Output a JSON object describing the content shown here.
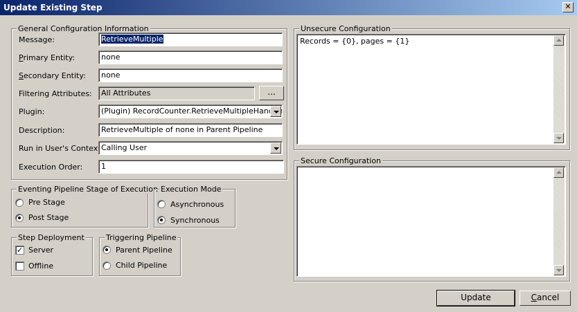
{
  "window": {
    "title": "Update Existing Step",
    "close_label": "✕"
  },
  "general": {
    "legend": "General Configuration Information",
    "message_label": "Message:",
    "message_value": "RetrieveMultiple",
    "primary_label_u": "P",
    "primary_label_rest": "rimary Entity:",
    "primary_value": "none",
    "secondary_label_u": "S",
    "secondary_label_rest": "econdary Entity:",
    "secondary_value": "none",
    "filtering_label": "Filtering Attributes:",
    "filtering_value": "All Attributes",
    "filtering_button": "...",
    "plugin_label": "Plugin:",
    "plugin_value": "(Plugin) RecordCounter.RetrieveMultipleHandler",
    "description_label": "Description:",
    "description_value": "RetrieveMultiple of none in Parent Pipeline",
    "context_label": "Run in User's Context:",
    "context_value": "Calling User",
    "order_label": "Execution Order:",
    "order_value": "1"
  },
  "stage": {
    "legend": "Eventing Pipeline Stage of Execution",
    "pre": "Pre Stage",
    "post": "Post Stage",
    "selected": "post"
  },
  "mode": {
    "legend": "Execution Mode",
    "async": "Asynchronous",
    "sync": "Synchronous",
    "selected": "sync"
  },
  "deployment": {
    "legend": "Step Deployment",
    "server": "Server",
    "server_checked": true,
    "offline": "Offline",
    "offline_checked": false
  },
  "triggering": {
    "legend": "Triggering Pipeline",
    "parent": "Parent Pipeline",
    "child": "Child Pipeline",
    "selected": "parent"
  },
  "unsecure": {
    "legend": "Unsecure Configuration",
    "text": "Records = {0}, pages = {1}"
  },
  "secure": {
    "legend": "Secure Configuration",
    "text": ""
  },
  "buttons": {
    "update": "Update",
    "cancel_u": "C",
    "cancel_rest": "ancel"
  }
}
